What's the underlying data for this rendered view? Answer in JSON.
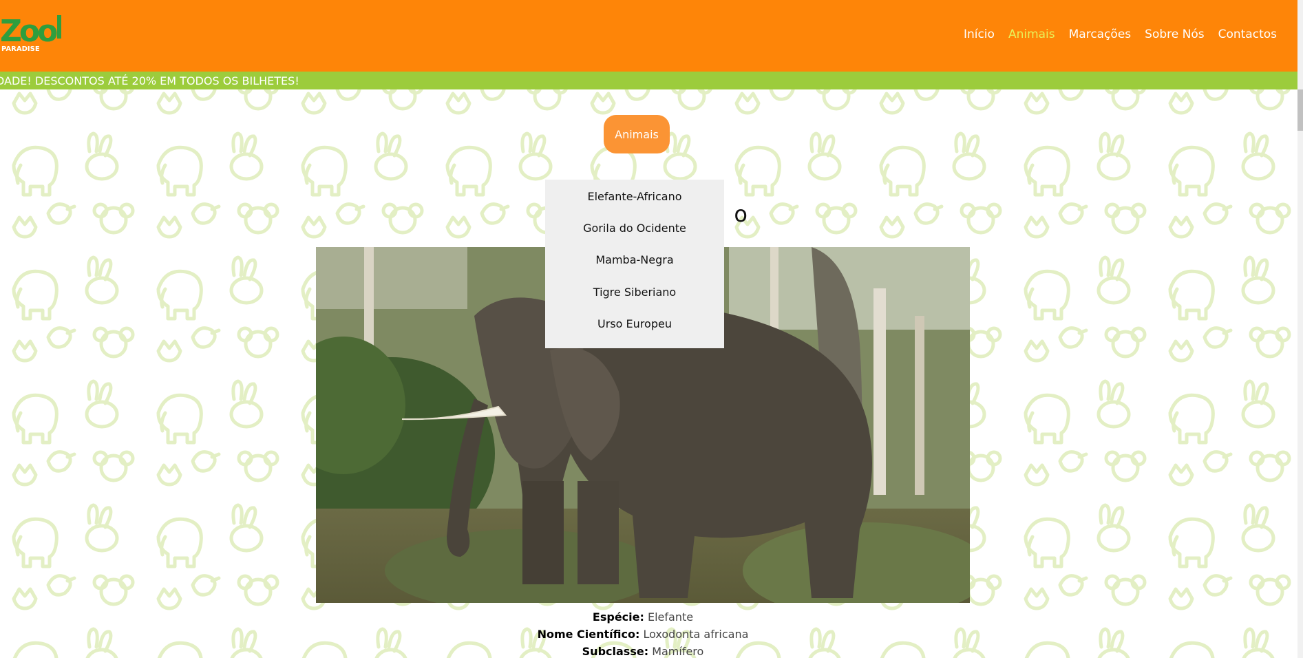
{
  "brand": {
    "logo_text": "Zoo",
    "logo_subtext": "PARADISE"
  },
  "nav": {
    "items": [
      {
        "label": "Início",
        "active": false
      },
      {
        "label": "Animais",
        "active": true
      },
      {
        "label": "Marcações",
        "active": false
      },
      {
        "label": "Sobre Nós",
        "active": false
      },
      {
        "label": "Contactos",
        "active": false
      }
    ]
  },
  "ticker": {
    "text": "DADE! DESCONTOS ATÉ 20% EM TODOS OS BILHETES!"
  },
  "animals_button": {
    "label": "Animais"
  },
  "dropdown": {
    "items": [
      "Elefante-Africano",
      "Gorila do Ocidente",
      "Mamba-Negra",
      "Tigre Siberiano",
      "Urso Europeu"
    ]
  },
  "page_title_visible": "o",
  "info": {
    "especie_label": "Espécie:",
    "especie_value": "Elefante",
    "cientifico_label": "Nome Científico:",
    "cientifico_value": "Loxodonta africana",
    "subclasse_label": "Subclasse:",
    "subclasse_value": "Mamífero"
  },
  "colors": {
    "header": "#fe8508",
    "ticker": "#9ccc3c",
    "nav_active": "#e8f25a",
    "button": "#fb9434",
    "dropdown_bg": "#efefef",
    "pattern": "#e3efc4"
  },
  "icons": [
    "elephant-icon",
    "rabbit-icon",
    "bird-icon",
    "fox-icon",
    "tiger-icon",
    "koala-icon",
    "bear-icon",
    "dog-icon"
  ]
}
